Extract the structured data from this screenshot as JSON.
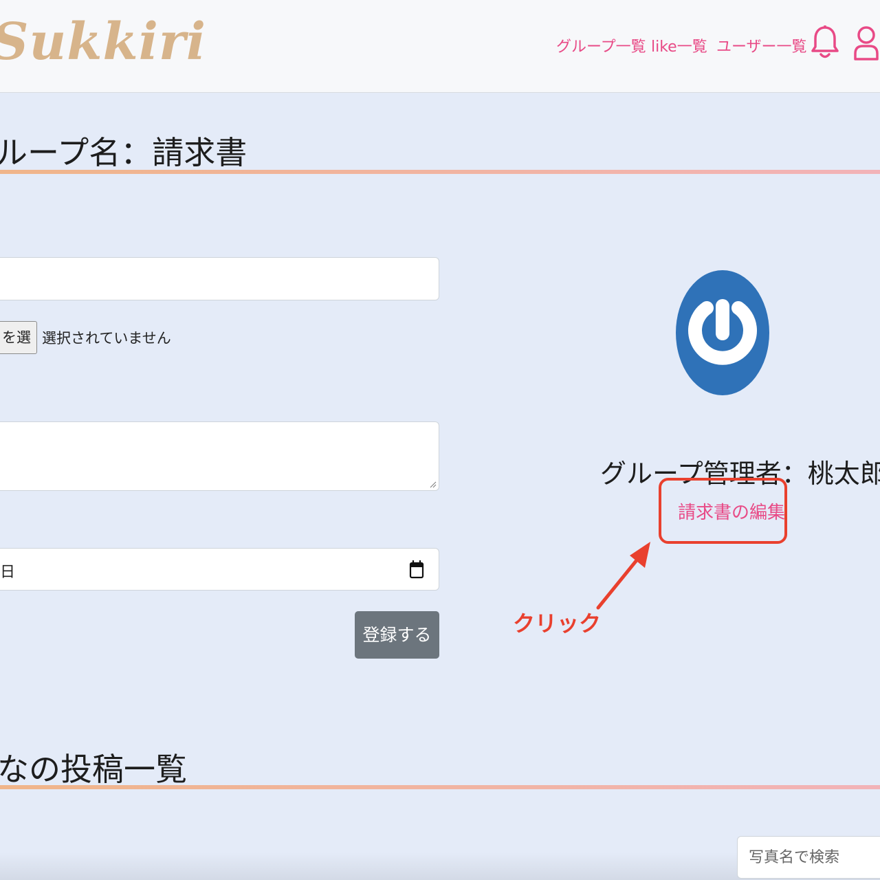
{
  "navbar": {
    "logo": "Sukkiri",
    "links": [
      "グループ一覧",
      "like一覧",
      "ユーザー一覧"
    ],
    "icons": [
      "bell-icon",
      "user-icon"
    ]
  },
  "group": {
    "heading": "ループ名：請求書"
  },
  "form": {
    "file_button_label": "を選択",
    "file_status": "選択されていません",
    "date_value": "日",
    "submit_label": "登録する"
  },
  "sidebar": {
    "admin_label": "グループ管理者：桃太郎",
    "edit_link": "請求書の編集"
  },
  "annotation": {
    "click_label": "クリック",
    "color": "#e9402e"
  },
  "posts": {
    "heading": "なの投稿一覧"
  },
  "search": {
    "placeholder": "写真名で検索"
  },
  "colors": {
    "accent": "#e84a86",
    "background": "#e4ebf8",
    "button": "#6c757d"
  }
}
